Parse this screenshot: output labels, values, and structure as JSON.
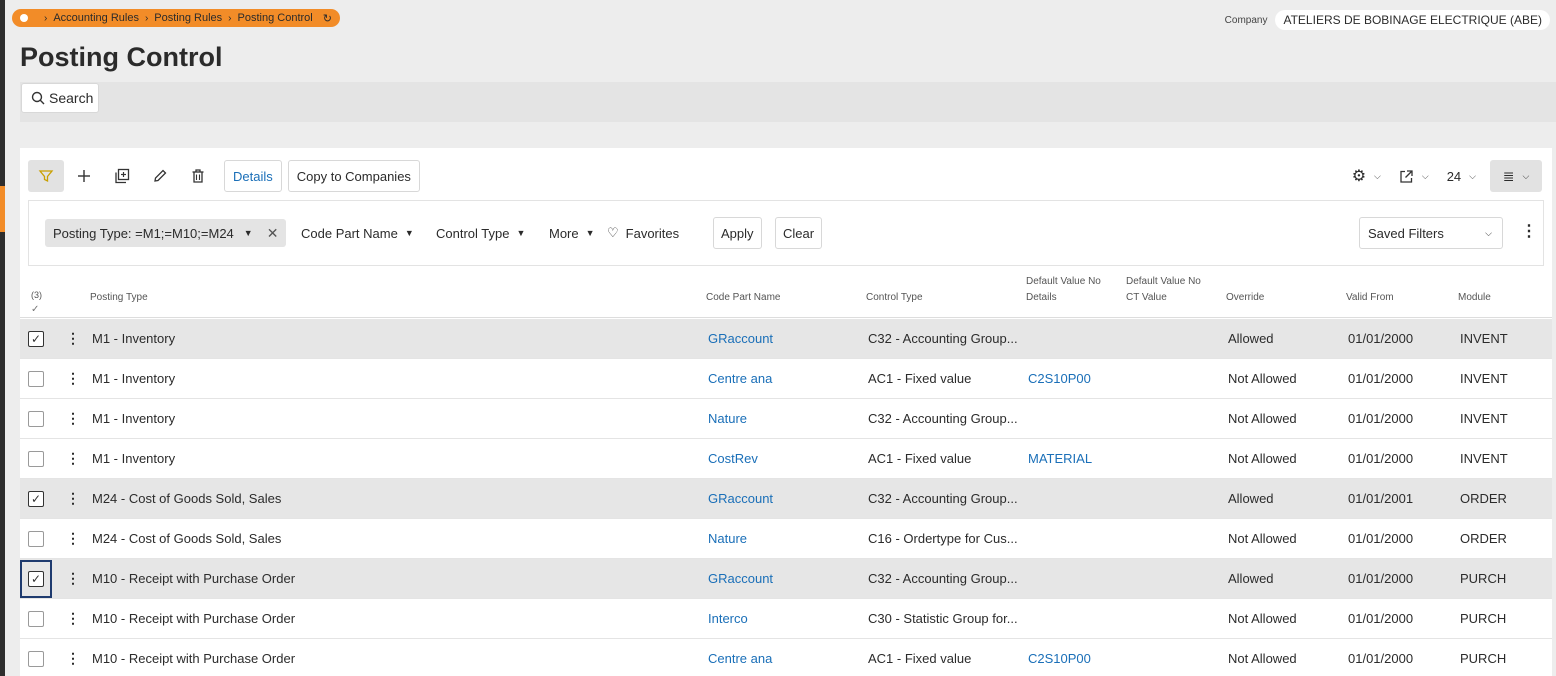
{
  "breadcrumb": {
    "items": [
      "Accounting Rules",
      "Posting Rules",
      "Posting Control"
    ]
  },
  "company": {
    "label": "Company",
    "value": "ATELIERS DE BOBINAGE ELECTRIQUE (ABE)"
  },
  "page": {
    "title": "Posting Control"
  },
  "search": {
    "label": "Search"
  },
  "toolbar": {
    "details_label": "Details",
    "copy_label": "Copy to Companies",
    "page_size": "24"
  },
  "filters": {
    "active_chip": "Posting Type: =M1;=M10;=M24",
    "code_part_name": "Code Part Name",
    "control_type": "Control Type",
    "more": "More",
    "favorites": "Favorites",
    "apply": "Apply",
    "clear": "Clear",
    "saved_filters": "Saved Filters"
  },
  "table": {
    "selected_count": "(3)",
    "columns": {
      "posting_type": "Posting Type",
      "code_part_name": "Code Part Name",
      "control_type": "Control Type",
      "default_value_no_details_1": "Default Value No",
      "default_value_no_details_2": "Details",
      "default_value_no_ct_1": "Default Value No",
      "default_value_no_ct_2": "CT Value",
      "override": "Override",
      "valid_from": "Valid From",
      "module": "Module"
    },
    "rows": [
      {
        "posting_type": "M1 - Inventory",
        "code_part": "GRaccount",
        "control_type": "C32 - Accounting Group...",
        "default_details": "",
        "override": "Allowed",
        "valid_from": "01/01/2000",
        "module": "INVENT",
        "selected": true
      },
      {
        "posting_type": "M1 - Inventory",
        "code_part": "Centre ana",
        "control_type": "AC1 - Fixed value",
        "default_details": "C2S10P00",
        "override": "Not Allowed",
        "valid_from": "01/01/2000",
        "module": "INVENT",
        "selected": false
      },
      {
        "posting_type": "M1 - Inventory",
        "code_part": "Nature",
        "control_type": "C32 - Accounting Group...",
        "default_details": "",
        "override": "Not Allowed",
        "valid_from": "01/01/2000",
        "module": "INVENT",
        "selected": false
      },
      {
        "posting_type": "M1 - Inventory",
        "code_part": "CostRev",
        "control_type": "AC1 - Fixed value",
        "default_details": "MATERIAL",
        "override": "Not Allowed",
        "valid_from": "01/01/2000",
        "module": "INVENT",
        "selected": false
      },
      {
        "posting_type": "M24 - Cost of Goods Sold, Sales",
        "code_part": "GRaccount",
        "control_type": "C32 - Accounting Group...",
        "default_details": "",
        "override": "Allowed",
        "valid_from": "01/01/2001",
        "module": "ORDER",
        "selected": true
      },
      {
        "posting_type": "M24 - Cost of Goods Sold, Sales",
        "code_part": "Nature",
        "control_type": "C16 - Ordertype for Cus...",
        "default_details": "",
        "override": "Not Allowed",
        "valid_from": "01/01/2000",
        "module": "ORDER",
        "selected": false
      },
      {
        "posting_type": "M10 - Receipt with Purchase Order",
        "code_part": "GRaccount",
        "control_type": "C32 - Accounting Group...",
        "default_details": "",
        "override": "Allowed",
        "valid_from": "01/01/2000",
        "module": "PURCH",
        "selected": true
      },
      {
        "posting_type": "M10 - Receipt with Purchase Order",
        "code_part": "Interco",
        "control_type": "C30 - Statistic Group for...",
        "default_details": "",
        "override": "Not Allowed",
        "valid_from": "01/01/2000",
        "module": "PURCH",
        "selected": false
      },
      {
        "posting_type": "M10 - Receipt with Purchase Order",
        "code_part": "Centre ana",
        "control_type": "AC1 - Fixed value",
        "default_details": "C2S10P00",
        "override": "Not Allowed",
        "valid_from": "01/01/2000",
        "module": "PURCH",
        "selected": false
      }
    ]
  },
  "colors": {
    "accent": "#f28c28",
    "link": "#1a6fb8",
    "selected_row": "#e6e6e6"
  }
}
